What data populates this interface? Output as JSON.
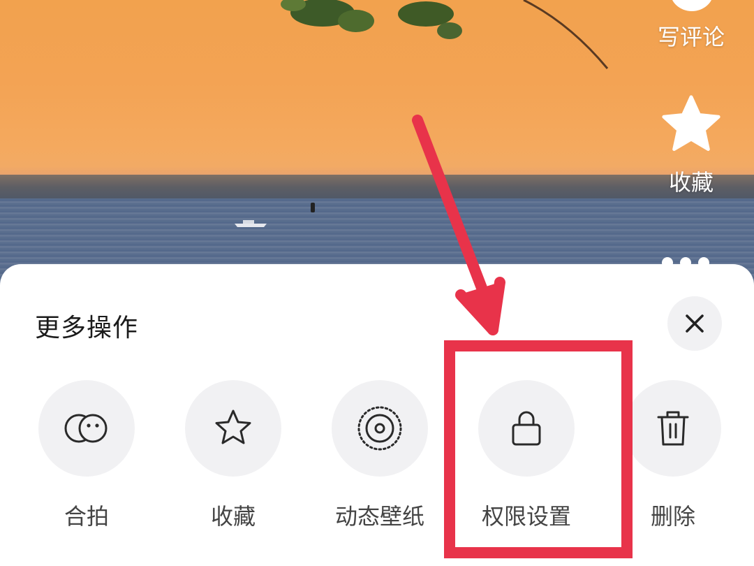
{
  "background": {
    "side_actions": {
      "comment_label": "写评论",
      "favorite_label": "收藏"
    }
  },
  "sheet": {
    "title": "更多操作",
    "close_icon": "close-icon",
    "actions": [
      {
        "label": "合拍",
        "icon": "duet-icon"
      },
      {
        "label": "收藏",
        "icon": "star-icon"
      },
      {
        "label": "动态壁纸",
        "icon": "live-wallpaper-icon"
      },
      {
        "label": "权限设置",
        "icon": "lock-icon"
      },
      {
        "label": "删除",
        "icon": "trash-icon"
      }
    ]
  },
  "annotation": {
    "color": "#e8334a",
    "target": "权限设置"
  }
}
